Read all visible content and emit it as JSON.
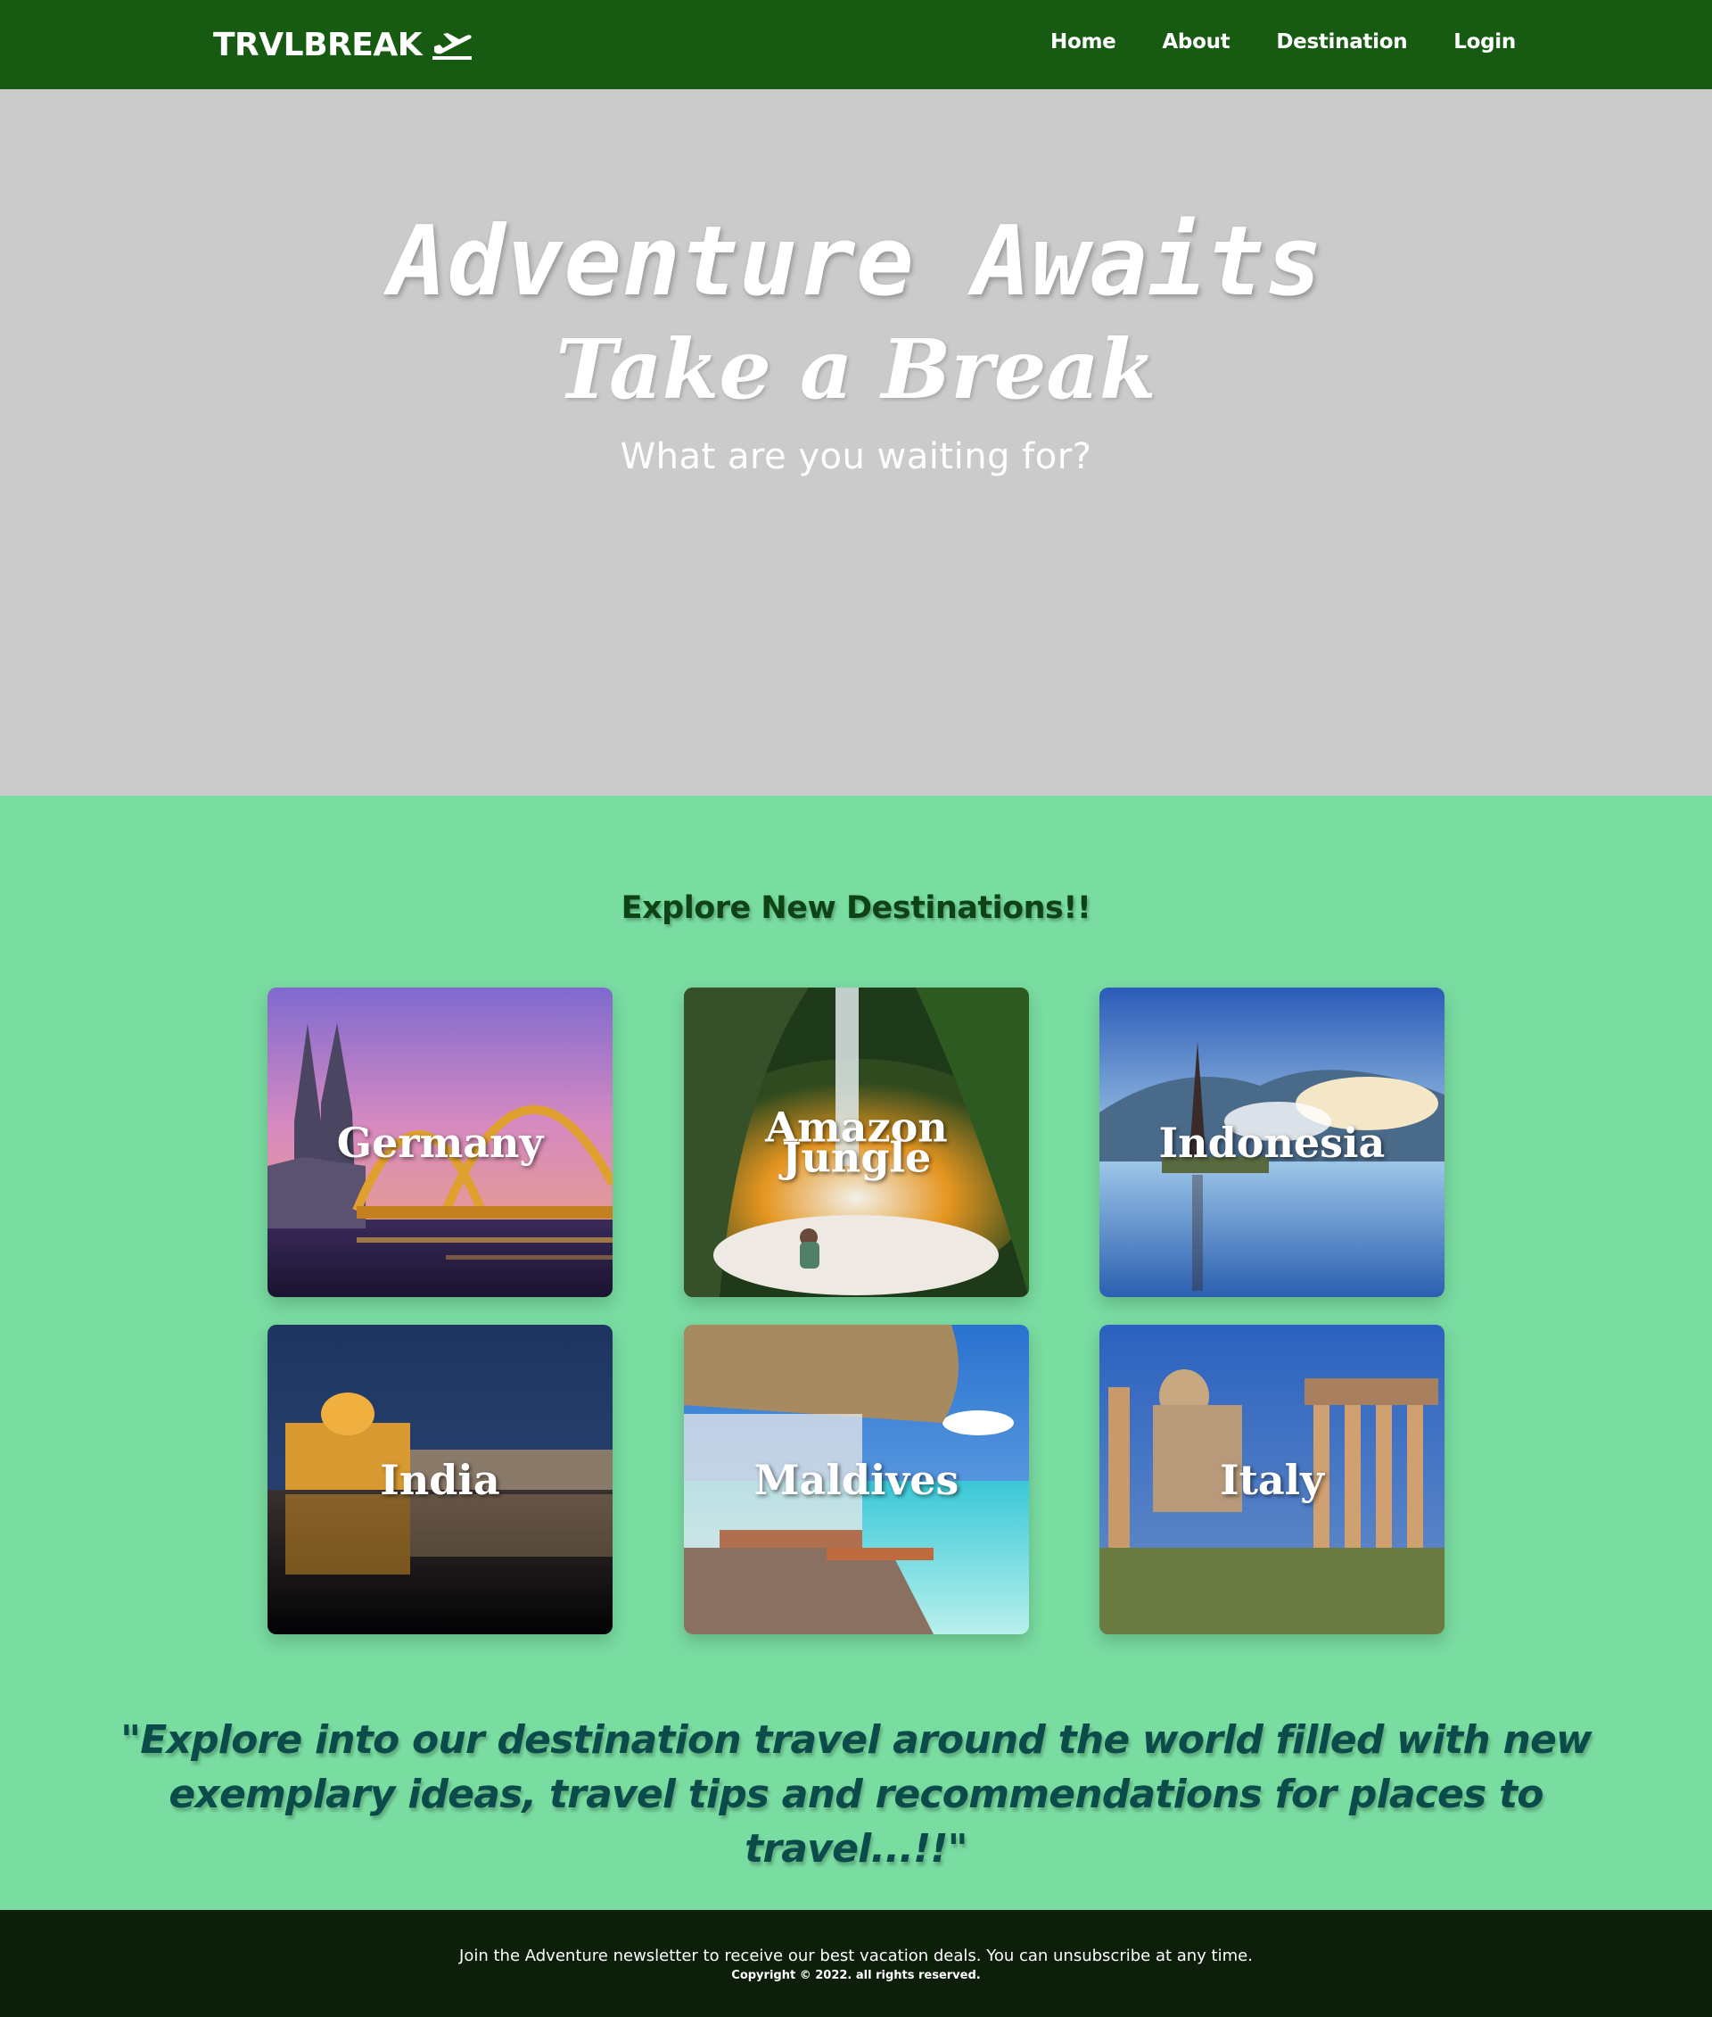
{
  "navbar": {
    "brand": "TRVLBREAK",
    "brand_icon": "plane-departure-icon",
    "links": [
      {
        "label": "Home"
      },
      {
        "label": "About"
      },
      {
        "label": "Destination"
      },
      {
        "label": "Login"
      }
    ]
  },
  "hero": {
    "title": "Adventure Awaits",
    "subtitle": "Take a Break",
    "tagline": "What are you waiting for?"
  },
  "destinations": {
    "heading": "Explore New Destinations!!",
    "cards": [
      {
        "label": "Germany"
      },
      {
        "label": "Amazon Jungle"
      },
      {
        "label": "Indonesia"
      },
      {
        "label": "India"
      },
      {
        "label": "Maldives"
      },
      {
        "label": "Italy"
      }
    ]
  },
  "quote": "\"Explore into our destination travel around the world filled with new exemplary ideas, travel tips and recommendations for places to travel...!!\"",
  "footer": {
    "newsletter": "Join the Adventure newsletter to receive our best vacation deals. You can unsubscribe at any time.",
    "copyright": "Copyright © 2022. all rights reserved."
  },
  "colors": {
    "navbar": "#175b13",
    "hero_bg": "#cbcbcb",
    "page_bg": "#79dca1",
    "heading": "#0e4316",
    "quote": "#0b4b4a",
    "footer": "#0d1f0b"
  }
}
